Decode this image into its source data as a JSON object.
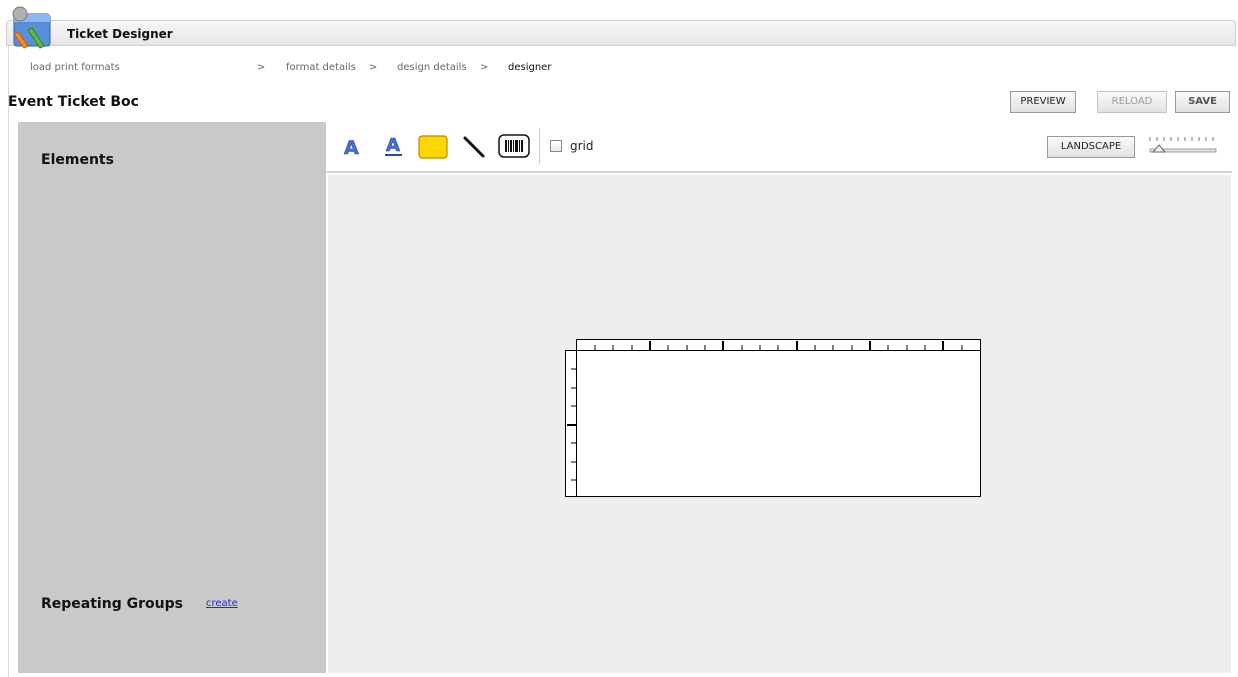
{
  "app": {
    "title": "Ticket Designer"
  },
  "breadcrumb": {
    "items": [
      "load print formats",
      "format details",
      "design details",
      "designer"
    ],
    "separator": ">"
  },
  "page": {
    "title": "Event Ticket Boc"
  },
  "actions": {
    "preview": "PREVIEW",
    "reload": "RELOAD",
    "save": "SAVE"
  },
  "left_panel": {
    "elements_heading": "Elements",
    "repeating_groups_heading": "Repeating Groups",
    "create_link": "create"
  },
  "toolbar": {
    "tools": [
      "text-icon",
      "underlined-text-icon",
      "rectangle-icon",
      "line-icon",
      "barcode-icon"
    ],
    "grid_label": "grid",
    "grid_checked": false,
    "orientation_button": "LANDSCAPE"
  },
  "colors": {
    "panel": "#c9c9c9",
    "canvas": "#eeeeee",
    "rectangle_fill": "#ffd700",
    "link": "#1a2fd6",
    "text_tool": "#4a6fc9"
  }
}
